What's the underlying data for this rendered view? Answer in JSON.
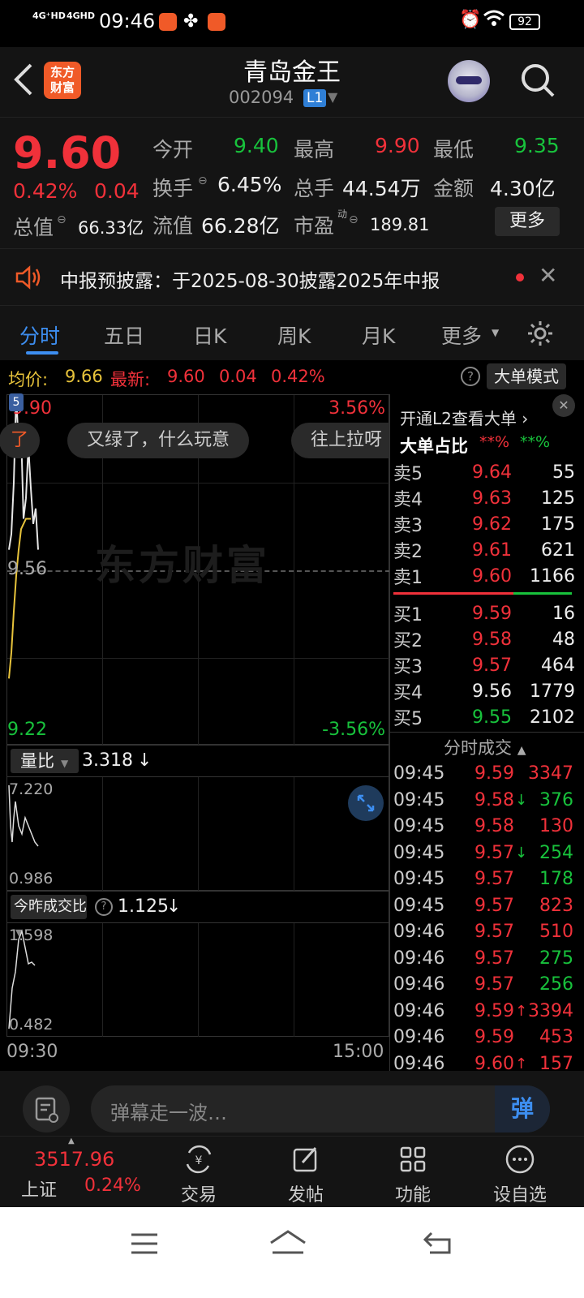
{
  "status_bar": {
    "network1": "4G⁺HD",
    "network2": "4GHD",
    "time": "09:46",
    "battery": "92"
  },
  "header": {
    "back_icon": "chevron-left-icon",
    "logo_line1": "东方",
    "logo_line2": "财富",
    "stock_name": "青岛金王",
    "stock_code": "002094",
    "level_badge": "L1",
    "assistant_icon": "robot-avatar-icon",
    "search_icon": "search-icon"
  },
  "quote": {
    "price": "9.60",
    "change_pct": "0.42%",
    "change_abs": "0.04",
    "open_label": "今开",
    "open": "9.40",
    "high_label": "最高",
    "high": "9.90",
    "low_label": "最低",
    "low": "9.35",
    "turnover_label": "换手",
    "turnover": "6.45%",
    "volume_label": "总手",
    "volume": "44.54万",
    "amount_label": "金额",
    "amount": "4.30亿",
    "mktcap_label": "总值",
    "mktcap": "66.33亿",
    "float_label": "流值",
    "float": "66.28亿",
    "pe_label": "市盈",
    "pe_sup": "动",
    "pe": "189.81",
    "more_button": "更多"
  },
  "announcement": {
    "text": "中报预披露：于2025-08-30披露2025年中报"
  },
  "tabs": [
    "分时",
    "五日",
    "日K",
    "周K",
    "月K",
    "更多"
  ],
  "summary": {
    "avg_label": "均价:",
    "avg": "9.66",
    "latest_label": "最新:",
    "latest": "9.60",
    "change": "0.04",
    "change_pct": "0.42%",
    "mode_button": "大单模式"
  },
  "chart": {
    "y_max": "9.90",
    "y_mid": "9.56",
    "y_min": "9.22",
    "pct_max": "3.56%",
    "pct_min": "-3.56%",
    "watermark": "东方财富",
    "danmu": [
      "了",
      "又绿了，什么玩意",
      "往上拉呀"
    ],
    "marker": "5",
    "volume_ratio_label": "量比",
    "volume_ratio": "3.318",
    "volume_ratio_arrow": "↓",
    "vr_top": "7.220",
    "vr_bottom": "0.986",
    "today_vs_yday_label": "今昨成交比",
    "today_vs_yday": "1.125",
    "today_vs_yday_arrow": "↓",
    "ty_top": "1.598",
    "ty_bottom": "0.482",
    "time_start": "09:30",
    "time_end": "15:00"
  },
  "chart_data": {
    "type": "line",
    "series": [
      {
        "values": [
          9.6,
          9.63,
          9.73,
          9.9,
          9.8,
          9.83,
          9.66,
          9.7,
          9.8,
          9.72,
          9.65,
          9.68,
          9.6
        ]
      },
      {
        "values": [
          9.35,
          9.4,
          9.48,
          9.55,
          9.6,
          9.64,
          9.65,
          9.66,
          9.66,
          9.66
        ]
      }
    ]
  },
  "orderbook": {
    "l2_link": "开通L2查看大单",
    "ratio_label": "大单占比",
    "ratio_red": "**%",
    "ratio_green": "**%",
    "asks": [
      {
        "label": "卖5",
        "price": "9.64",
        "vol": "55"
      },
      {
        "label": "卖4",
        "price": "9.63",
        "vol": "125"
      },
      {
        "label": "卖3",
        "price": "9.62",
        "vol": "175"
      },
      {
        "label": "卖2",
        "price": "9.61",
        "vol": "621"
      },
      {
        "label": "卖1",
        "price": "9.60",
        "vol": "1166"
      }
    ],
    "bids": [
      {
        "label": "买1",
        "price": "9.59",
        "vol": "16"
      },
      {
        "label": "买2",
        "price": "9.58",
        "vol": "48"
      },
      {
        "label": "买3",
        "price": "9.57",
        "vol": "464"
      },
      {
        "label": "买4",
        "price": "9.56",
        "vol": "1779"
      },
      {
        "label": "买5",
        "price": "9.55",
        "vol": "2102"
      }
    ]
  },
  "trades": {
    "title": "分时成交",
    "rows": [
      {
        "time": "09:45",
        "price": "9.59",
        "arrow": "",
        "vol": "3347"
      },
      {
        "time": "09:45",
        "price": "9.58",
        "arrow": "↓",
        "vol": "376"
      },
      {
        "time": "09:45",
        "price": "9.58",
        "arrow": "",
        "vol": "130"
      },
      {
        "time": "09:45",
        "price": "9.57",
        "arrow": "↓",
        "vol": "254"
      },
      {
        "time": "09:45",
        "price": "9.57",
        "arrow": "",
        "vol": "178"
      },
      {
        "time": "09:45",
        "price": "9.57",
        "arrow": "",
        "vol": "823"
      },
      {
        "time": "09:46",
        "price": "9.57",
        "arrow": "",
        "vol": "510"
      },
      {
        "time": "09:46",
        "price": "9.57",
        "arrow": "",
        "vol": "275"
      },
      {
        "time": "09:46",
        "price": "9.57",
        "arrow": "",
        "vol": "256"
      },
      {
        "time": "09:46",
        "price": "9.59",
        "arrow": "↑",
        "vol": "3394"
      },
      {
        "time": "09:46",
        "price": "9.59",
        "arrow": "",
        "vol": "453"
      },
      {
        "time": "09:46",
        "price": "9.60",
        "arrow": "↑",
        "vol": "157"
      }
    ]
  },
  "comment": {
    "placeholder": "弹幕走一波…",
    "danmu_button": "弹"
  },
  "bottom_nav": {
    "index_value": "3517.96",
    "index_name": "上证",
    "index_change": "0.24%",
    "trade": "交易",
    "post": "发帖",
    "functions": "功能",
    "watchlist": "设自选"
  }
}
